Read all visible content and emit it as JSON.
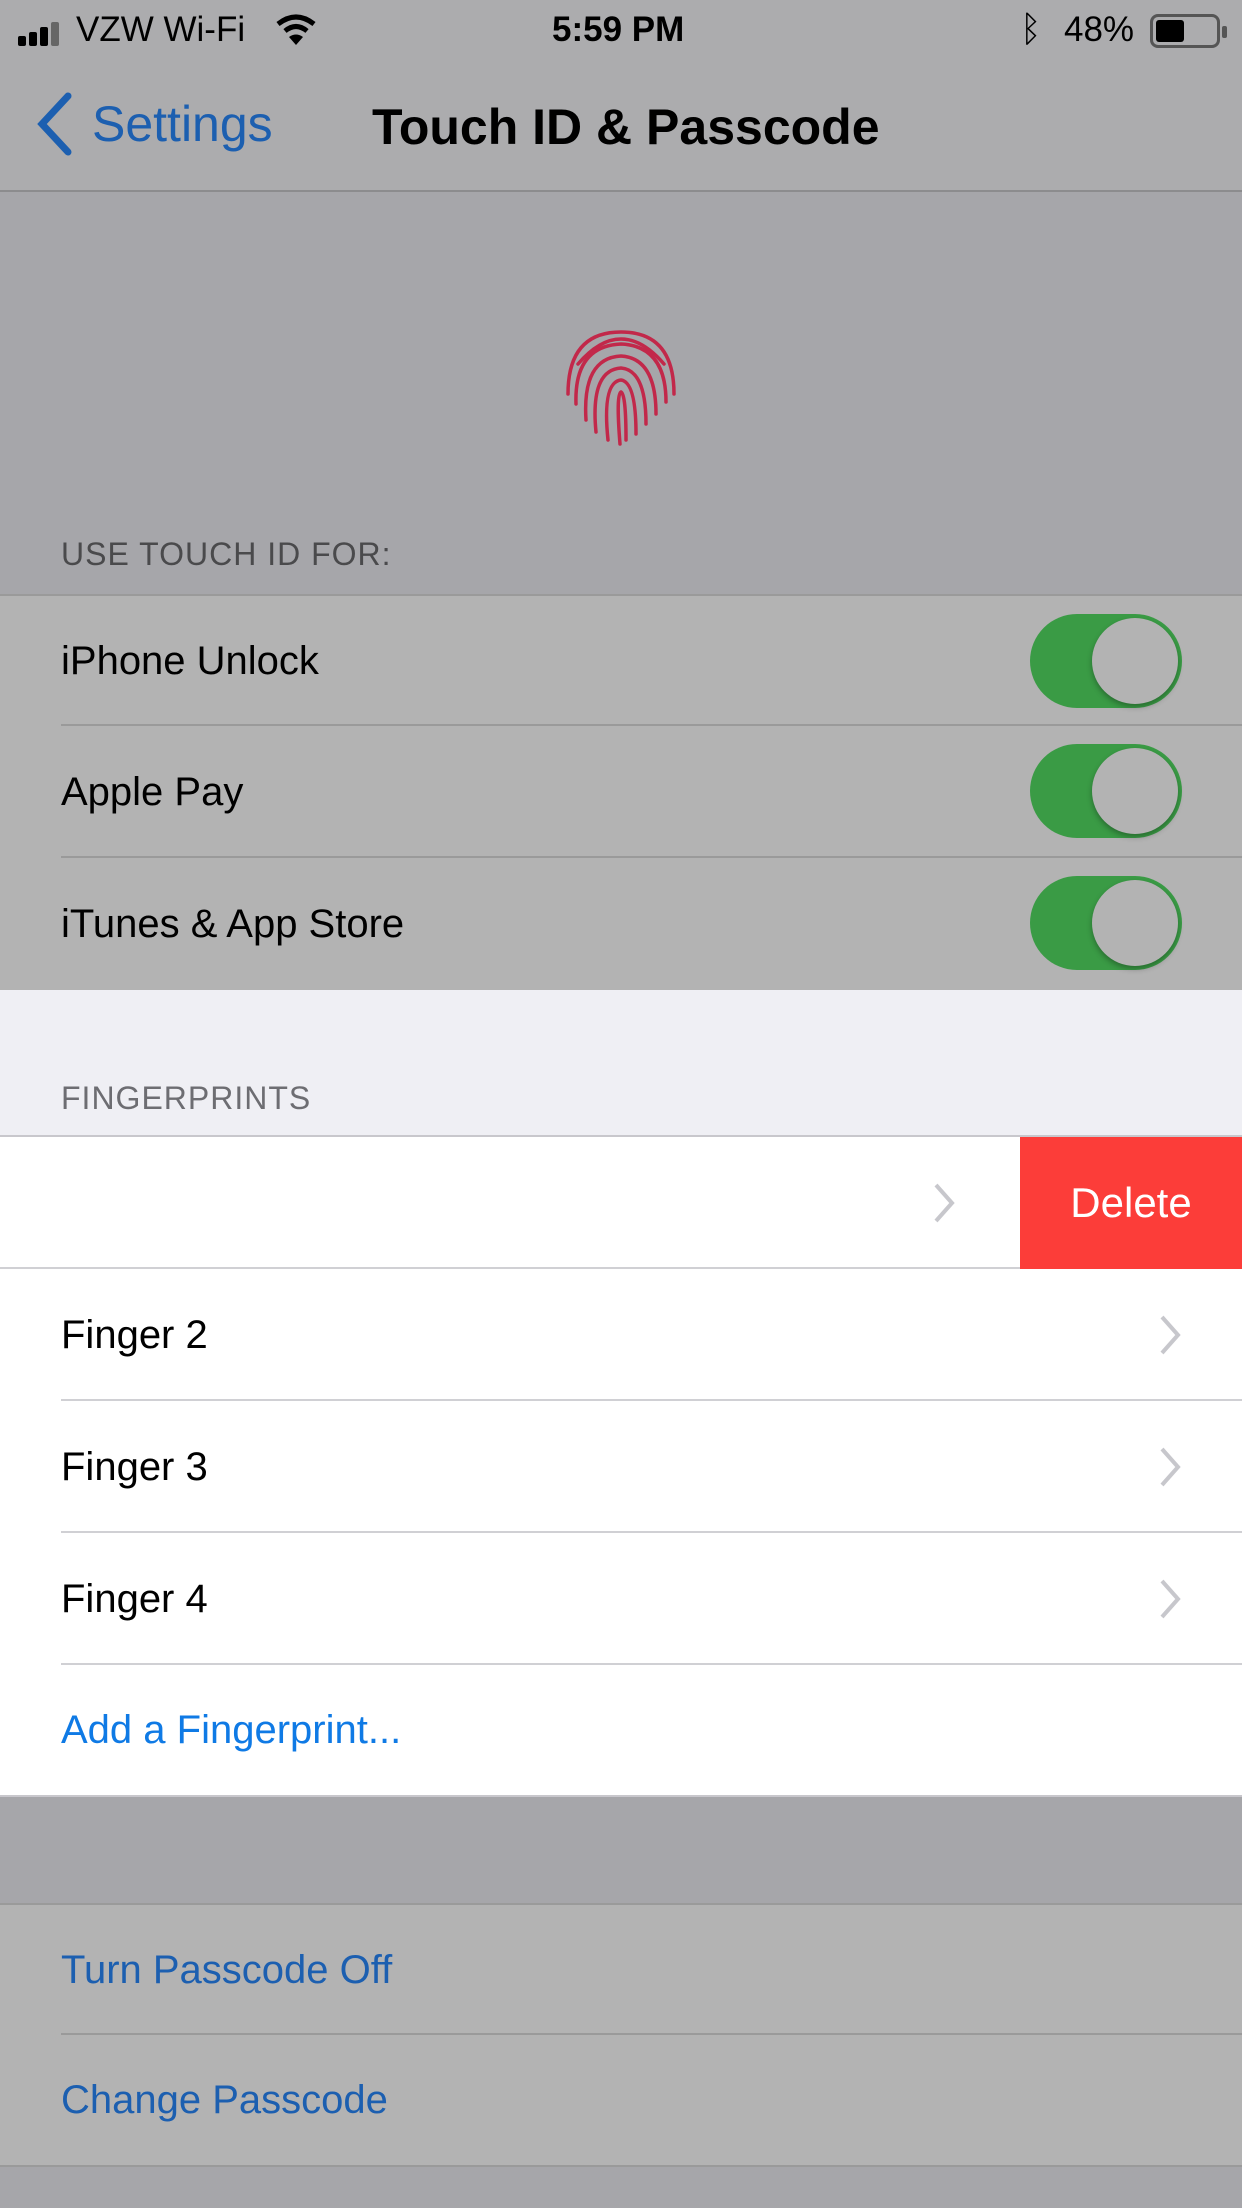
{
  "status_bar": {
    "carrier": "VZW Wi-Fi",
    "time": "5:59 PM",
    "battery": "48%",
    "battery_level": 0.48
  },
  "nav": {
    "back_label": "Settings",
    "title": "Touch ID & Passcode"
  },
  "touch_id": {
    "section_label": "USE TOUCH ID FOR:",
    "items": [
      {
        "label": "iPhone Unlock",
        "on": true
      },
      {
        "label": "Apple Pay",
        "on": true
      },
      {
        "label": "iTunes & App Store",
        "on": true
      }
    ]
  },
  "fingerprints": {
    "section_label": "FINGERPRINTS",
    "delete_label": "Delete",
    "items": [
      {
        "label": ""
      },
      {
        "label": "Finger 2"
      },
      {
        "label": "Finger 3"
      },
      {
        "label": "Finger 4"
      }
    ],
    "add_label": "Add a Fingerprint..."
  },
  "passcode": {
    "items": [
      {
        "label": "Turn Passcode Off"
      },
      {
        "label": "Change Passcode"
      }
    ]
  },
  "colors": {
    "toggle_on": "#3a9b45",
    "delete": "#fc3d39",
    "link": "#0f7ae5",
    "link_dimmed": "#1c5fb0",
    "fingerprint_icon": "#c2284a"
  }
}
